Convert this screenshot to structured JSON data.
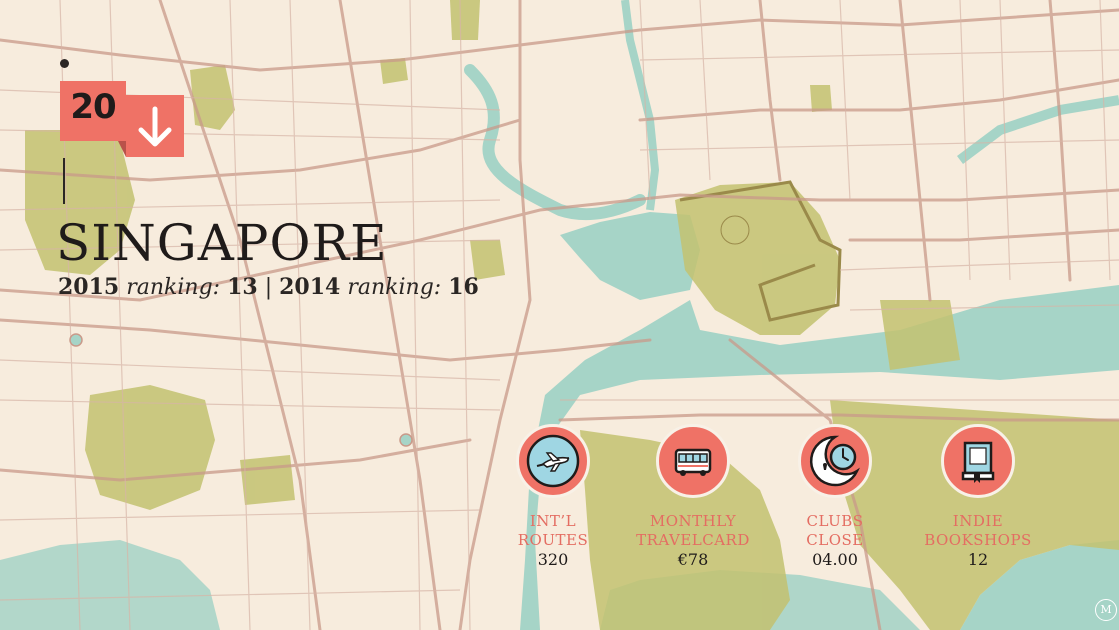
{
  "rank": {
    "number": "20",
    "trend": "down"
  },
  "city": {
    "name": "SINGAPORE"
  },
  "rankings": {
    "year_2015": "2015",
    "label_2015": "ranking:",
    "value_2015": "13",
    "separator": "|",
    "year_2014": "2014",
    "label_2014": "ranking:",
    "value_2014": "16"
  },
  "stats": [
    {
      "label_line1": "INT’L",
      "label_line2": "ROUTES",
      "value": "320",
      "icon": "airplane-icon"
    },
    {
      "label_line1": "MONTHLY",
      "label_line2": "TRAVELCARD",
      "value": "€78",
      "icon": "bus-icon"
    },
    {
      "label_line1": "CLUBS",
      "label_line2": "CLOSE",
      "value": "04.00",
      "icon": "moon-clock-icon"
    },
    {
      "label_line1": "INDIE",
      "label_line2": "BOOKSHOPS",
      "value": "12",
      "icon": "book-icon"
    }
  ],
  "logo": {
    "text": "M"
  },
  "colors": {
    "land": "#f7ecdd",
    "water": "#9fcfc3",
    "park": "#c3c270",
    "road": "#c99a8a",
    "accent": "#ef7266",
    "text": "#1f1b1a"
  }
}
